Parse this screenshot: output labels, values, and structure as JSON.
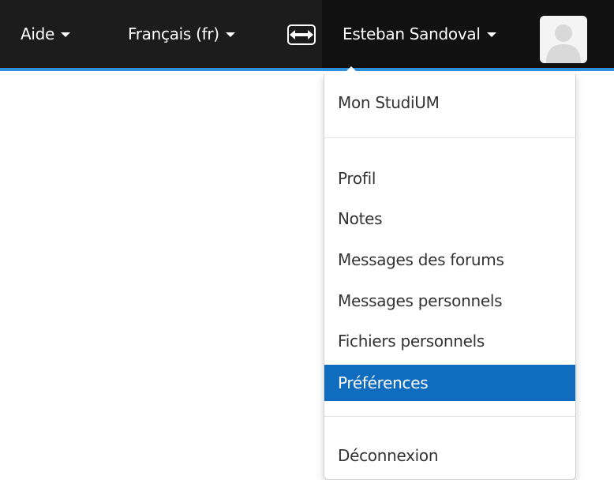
{
  "navbar": {
    "help_label": "Aide",
    "language_label": "Français (fr)",
    "user_name": "Esteban Sandoval"
  },
  "user_menu": {
    "items": [
      {
        "label": "Mon StudiUM"
      },
      {
        "label": "Profil"
      },
      {
        "label": "Notes"
      },
      {
        "label": "Messages des forums"
      },
      {
        "label": "Messages personnels"
      },
      {
        "label": "Fichiers personnels"
      },
      {
        "label": "Préférences",
        "active": true
      },
      {
        "label": "Déconnexion"
      }
    ]
  },
  "colors": {
    "navbar_bg": "#1c1c1c",
    "navbar_border": "#2f8fd6",
    "active_item_bg": "#0f6cbf"
  }
}
